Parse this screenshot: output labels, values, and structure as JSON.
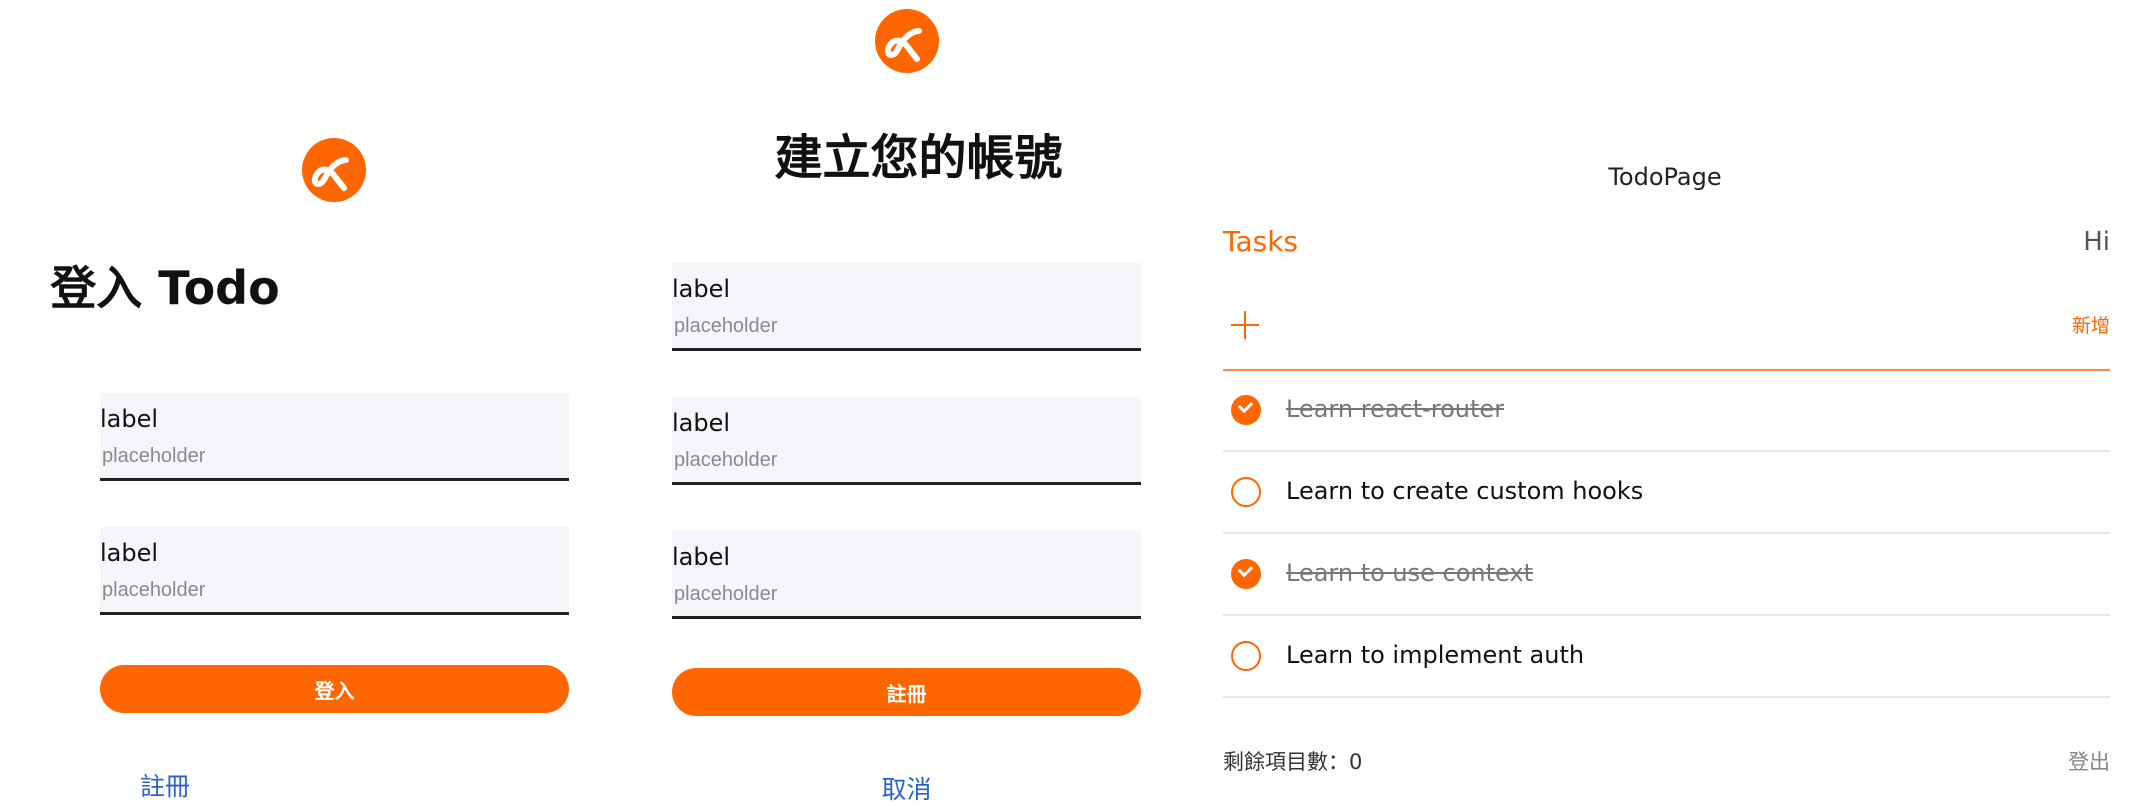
{
  "colors": {
    "accent": "#ff6600",
    "link": "#2a63c8",
    "field_bg": "#f4f6f9"
  },
  "logo": {
    "icon": "alpha-logo-icon"
  },
  "login": {
    "title": "登入 Todo",
    "fields": [
      {
        "label": "label",
        "placeholder": "placeholder"
      },
      {
        "label": "label",
        "placeholder": "placeholder"
      }
    ],
    "submit_label": "登入",
    "register_link": "註冊"
  },
  "signup": {
    "title": "建立您的帳號",
    "fields": [
      {
        "label": "label",
        "placeholder": "placeholder"
      },
      {
        "label": "label",
        "placeholder": "placeholder"
      },
      {
        "label": "label",
        "placeholder": "placeholder"
      }
    ],
    "submit_label": "註冊",
    "cancel_link": "取消"
  },
  "todo": {
    "page_title": "TodoPage",
    "tasks_title": "Tasks",
    "greeting": "Hi",
    "add_icon": "plus-icon",
    "add_label": "新增",
    "items": [
      {
        "text": "Learn react-router",
        "done": true
      },
      {
        "text": "Learn to create custom hooks",
        "done": false
      },
      {
        "text": "Learn to use context",
        "done": true
      },
      {
        "text": "Learn to implement auth",
        "done": false
      }
    ],
    "remaining_label": "剩餘項目數：0",
    "logout_label": "登出"
  }
}
